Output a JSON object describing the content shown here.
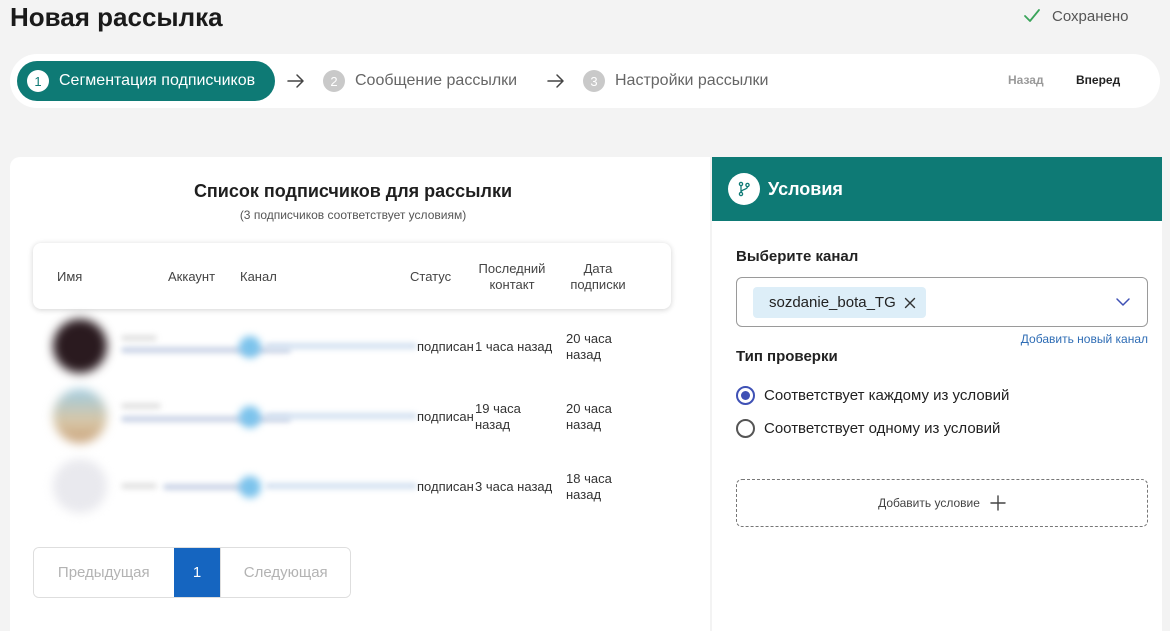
{
  "header": {
    "title": "Новая рассылка",
    "saved_label": "Сохранено"
  },
  "stepper": {
    "steps": [
      {
        "num": "1",
        "label": "Сегментация подписчиков"
      },
      {
        "num": "2",
        "label": "Сообщение рассылки"
      },
      {
        "num": "3",
        "label": "Настройки рассылки"
      }
    ],
    "back_label": "Назад",
    "next_label": "Вперед"
  },
  "subscribers": {
    "title": "Список подписчиков для рассылки",
    "subtitle": "(3 подписчиков соответствует условиям)",
    "columns": {
      "name": "Имя",
      "account": "Аккаунт",
      "channel": "Канал",
      "status": "Статус",
      "last_contact": "Последний контакт",
      "subscribed": "Дата подписки"
    },
    "rows": [
      {
        "status": "подписан",
        "last_contact": "1 часа назад",
        "subscribed": "20 часа назад"
      },
      {
        "status": "подписан",
        "last_contact": "19 часа назад",
        "subscribed": "20 часа назад"
      },
      {
        "status": "подписан",
        "last_contact": "3 часа назад",
        "subscribed": "18 часа назад"
      }
    ]
  },
  "pagination": {
    "prev_label": "Предыдущая",
    "current_page": "1",
    "next_label": "Следующая"
  },
  "conditions": {
    "title": "Условия",
    "channel_label": "Выберите канал",
    "selected_channel": "sozdanie_bota_TG",
    "add_channel_label": "Добавить новый канал",
    "check_type_label": "Тип проверки",
    "options": [
      {
        "label": "Соответствует каждому из условий",
        "selected": true
      },
      {
        "label": "Соответствует одному из условий",
        "selected": false
      }
    ],
    "add_condition_label": "Добавить условие"
  },
  "colors": {
    "accent": "#0e7a75",
    "page_active": "#1565c0",
    "radio": "#3f51b5"
  }
}
